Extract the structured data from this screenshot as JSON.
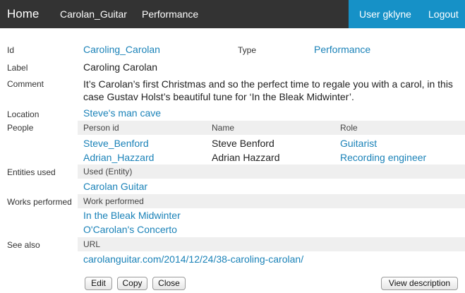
{
  "topbar": {
    "home": "Home",
    "collection": "Carolan_Guitar",
    "type": "Performance",
    "user": "User gklyne",
    "logout": "Logout"
  },
  "fields": {
    "id_label": "Id",
    "id_value": "Caroling_Carolan",
    "type_label": "Type",
    "type_value": "Performance",
    "label_label": "Label",
    "label_value": "Caroling Carolan",
    "comment_label": "Comment",
    "comment_value": "It’s Carolan’s first Christmas and so the perfect time to regale you with a carol, in this case Gustav Holst’s beautiful tune for ‘In the Bleak Midwinter’.",
    "location_label": "Location",
    "location_value": "Steve's man cave"
  },
  "people": {
    "label": "People",
    "columns": [
      "Person id",
      "Name",
      "Role"
    ],
    "rows": [
      {
        "id": "Steve_Benford",
        "name": "Steve Benford",
        "role": "Guitarist"
      },
      {
        "id": "Adrian_Hazzard",
        "name": "Adrian Hazzard",
        "role": "Recording engineer"
      }
    ]
  },
  "entities": {
    "label": "Entities used",
    "header": "Used (Entity)",
    "items": [
      "Carolan Guitar"
    ]
  },
  "works": {
    "label": "Works performed",
    "header": "Work performed",
    "items": [
      "In the Bleak Midwinter",
      "O'Carolan's Concerto"
    ]
  },
  "see_also": {
    "label": "See also",
    "header": "URL",
    "items": [
      "carolanguitar.com/2014/12/24/38-caroling-carolan/"
    ]
  },
  "buttons": {
    "edit": "Edit",
    "copy": "Copy",
    "close": "Close",
    "view_description": "View description"
  }
}
